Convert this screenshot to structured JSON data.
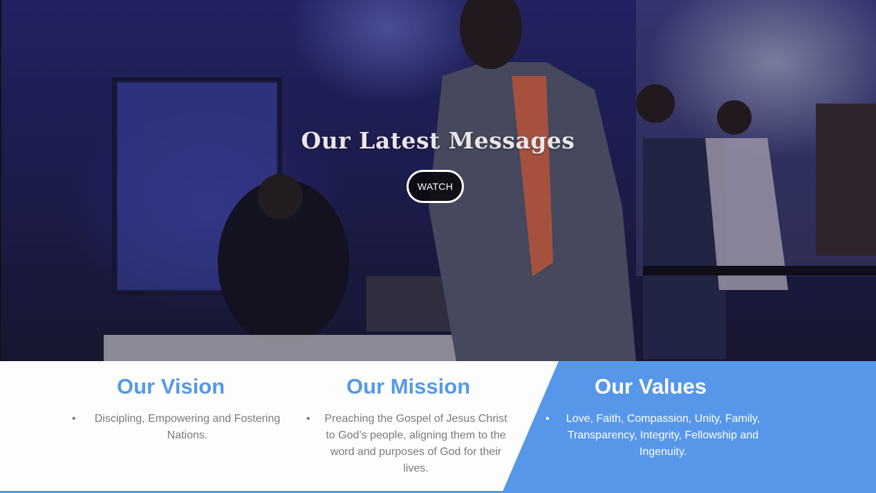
{
  "hero": {
    "title": "Our Latest Messages",
    "button_label": "WATCH"
  },
  "sections": {
    "vision": {
      "title": "Our Vision",
      "items": [
        "Discipling, Empowering and Fostering Nations."
      ]
    },
    "mission": {
      "title": "Our Mission",
      "items": [
        "Preaching the Gospel of Jesus Christ to God’s people, aligning them to the word and purposes of God for their lives."
      ]
    },
    "values": {
      "title": "Our Values",
      "items": [
        "Love, Faith, Compassion, Unity, Family, Transparency, Integrity, Fellowship and Ingenuity."
      ]
    }
  },
  "colors": {
    "accent": "#5697ea",
    "heading_blue": "#5599e9",
    "body_text": "#7a7a7a",
    "button_bg": "#0a0a0f"
  }
}
